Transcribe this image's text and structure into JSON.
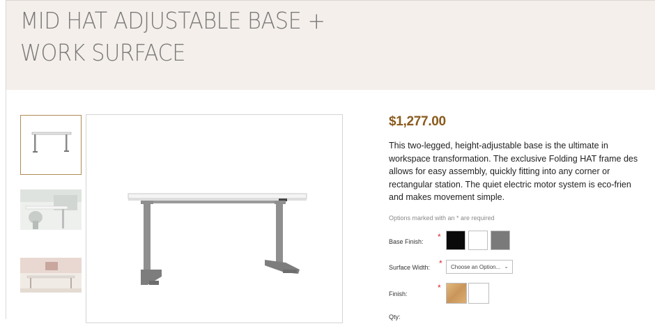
{
  "product": {
    "title_line1": "MID HAT ADJUSTABLE BASE +",
    "title_line2": "WORK SURFACE",
    "price": "$1,277.00",
    "description_lines": [
      "This two-legged, height-adjustable base is the ultimate in",
      "workspace transformation. The exclusive Folding HAT frame des",
      "allows for easy assembly, quickly fitting into any corner or",
      "rectangular station. The quiet electric motor system is eco-frien",
      "and makes movement simple."
    ]
  },
  "options": {
    "required_note": "Options marked with an * are required",
    "required_marker": "*",
    "base_finish": {
      "label": "Base Finish:",
      "swatch_colors": [
        "#0a0a0a",
        "#ffffff",
        "#7a7a7a"
      ]
    },
    "surface_width": {
      "label": "Surface Width:",
      "selected": "Choose an Option..."
    },
    "finish": {
      "label": "Finish:",
      "swatch_colors": [
        "#d6a86a",
        "#ffffff"
      ]
    },
    "qty": {
      "label": "Qty:"
    }
  },
  "colors": {
    "accent_price": "#8a5a1c",
    "hero_bg": "#f4efea",
    "thumb_selected_border": "#b08a55",
    "desk_top": "#f2f2f2",
    "desk_frame": "#8f8f8f"
  }
}
